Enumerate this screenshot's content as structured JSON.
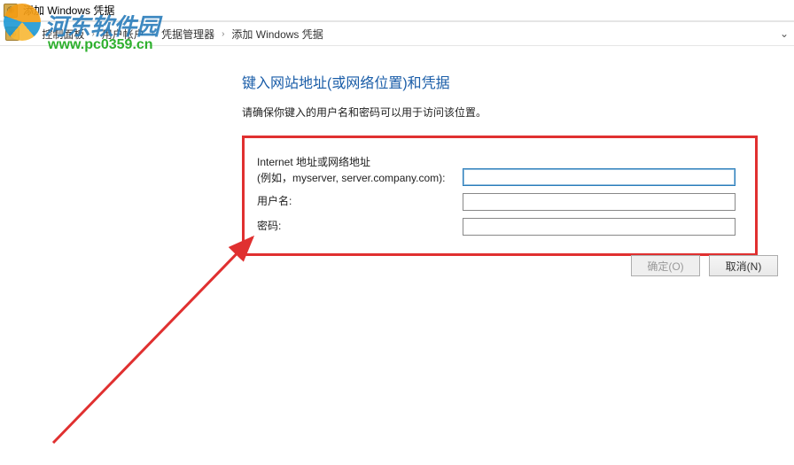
{
  "window": {
    "title": "添加 Windows 凭据"
  },
  "breadcrumb": {
    "sep": "›",
    "items": [
      "控制面板",
      "用户帐户",
      "凭据管理器",
      "添加 Windows 凭据"
    ]
  },
  "watermark": {
    "line1": "河东软件园",
    "line2": "www.pc0359.cn"
  },
  "page": {
    "heading": "键入网站地址(或网络位置)和凭据",
    "subheading": "请确保你键入的用户名和密码可以用于访问该位置。"
  },
  "form": {
    "address_label_line1": "Internet 地址或网络地址",
    "address_label_line2": "(例如，myserver, server.company.com):",
    "address_value": "",
    "username_label": "用户名:",
    "username_value": "",
    "password_label": "密码:",
    "password_value": ""
  },
  "buttons": {
    "ok": "确定(O)",
    "cancel": "取消(N)"
  }
}
